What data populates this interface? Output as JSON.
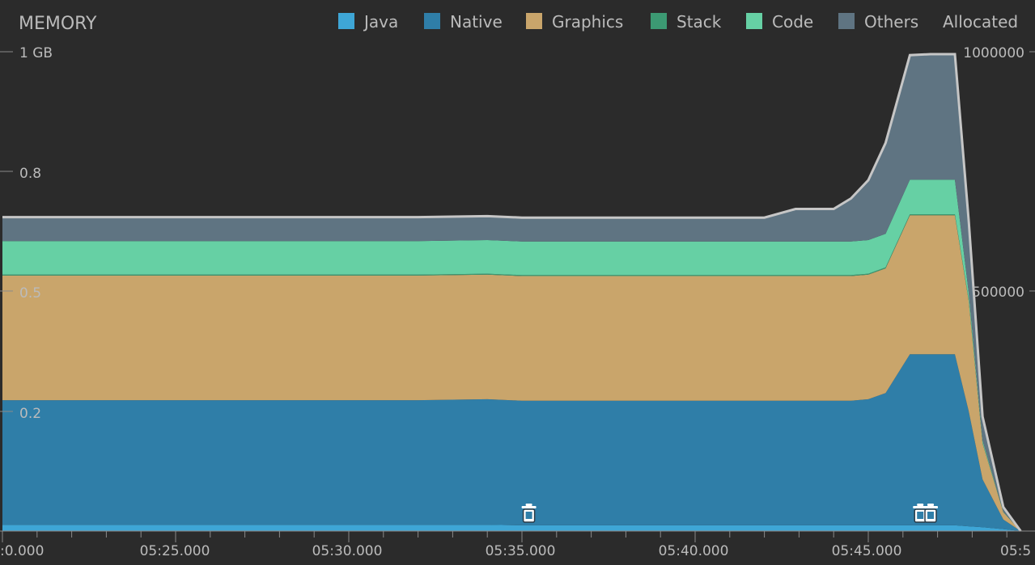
{
  "panel": {
    "title": "MEMORY"
  },
  "legend": [
    {
      "name": "Java",
      "color": "#3ea6d6"
    },
    {
      "name": "Native",
      "color": "#2f7ea8"
    },
    {
      "name": "Graphics",
      "color": "#c9a56b"
    },
    {
      "name": "Stack",
      "color": "#3c9a73"
    },
    {
      "name": "Code",
      "color": "#66d0a4"
    },
    {
      "name": "Others",
      "color": "#5f7482"
    },
    {
      "name": "Allocated",
      "color": null
    }
  ],
  "colors": {
    "background": "#2b2b2b",
    "total_line": "#c6c6c6",
    "axis": "#8a8a8a",
    "text": "#bbbbbb"
  },
  "chart_data": {
    "type": "area",
    "stacked": true,
    "x_tick_labels": [
      ":0.000",
      "05:25.000",
      "05:30.000",
      "05:35.000",
      "05:40.000",
      "05:45.000",
      "05:5"
    ],
    "y_left": {
      "unit": "GB",
      "ylim": [
        0,
        1
      ],
      "tick_labels": [
        "1 GB",
        "0.8",
        "0.5",
        "0.2"
      ]
    },
    "y_right": {
      "ylim": [
        0,
        1000000
      ],
      "tick_labels": [
        "1000000",
        "500000"
      ]
    },
    "x": [
      0,
      2,
      4,
      6,
      8,
      10,
      12,
      14,
      15,
      19,
      22,
      22.9,
      24,
      24.5,
      25,
      25.5,
      26.2,
      26.8,
      27.5,
      27.9,
      28.3,
      28.9,
      29.4
    ],
    "series": [
      {
        "name": "Java",
        "values": [
          0.013,
          0.013,
          0.013,
          0.013,
          0.013,
          0.013,
          0.013,
          0.013,
          0.012,
          0.012,
          0.012,
          0.012,
          0.012,
          0.012,
          0.012,
          0.012,
          0.012,
          0.012,
          0.012,
          0.01,
          0.008,
          0.004,
          0.0
        ]
      },
      {
        "name": "Native",
        "values": [
          0.26,
          0.26,
          0.26,
          0.26,
          0.26,
          0.26,
          0.26,
          0.262,
          0.26,
          0.26,
          0.26,
          0.26,
          0.26,
          0.26,
          0.263,
          0.276,
          0.357,
          0.357,
          0.357,
          0.24,
          0.1,
          0.02,
          0.0
        ]
      },
      {
        "name": "Graphics",
        "values": [
          0.26,
          0.26,
          0.26,
          0.26,
          0.26,
          0.26,
          0.26,
          0.26,
          0.26,
          0.26,
          0.26,
          0.26,
          0.26,
          0.26,
          0.26,
          0.26,
          0.29,
          0.29,
          0.29,
          0.23,
          0.075,
          0.015,
          0.0
        ]
      },
      {
        "name": "Stack",
        "values": [
          0.002,
          0.002,
          0.002,
          0.002,
          0.002,
          0.002,
          0.002,
          0.002,
          0.002,
          0.002,
          0.002,
          0.002,
          0.002,
          0.002,
          0.002,
          0.002,
          0.002,
          0.002,
          0.002,
          0.002,
          0.001,
          0.0,
          0.0
        ]
      },
      {
        "name": "Code",
        "values": [
          0.07,
          0.07,
          0.07,
          0.07,
          0.07,
          0.07,
          0.07,
          0.07,
          0.07,
          0.07,
          0.07,
          0.07,
          0.07,
          0.07,
          0.07,
          0.07,
          0.072,
          0.072,
          0.072,
          0.015,
          0.005,
          0.001,
          0.0
        ]
      },
      {
        "name": "Others",
        "values": [
          0.05,
          0.05,
          0.05,
          0.05,
          0.05,
          0.05,
          0.05,
          0.05,
          0.05,
          0.05,
          0.05,
          0.068,
          0.068,
          0.09,
          0.125,
          0.19,
          0.26,
          0.262,
          0.262,
          0.15,
          0.05,
          0.01,
          0.0
        ]
      }
    ],
    "gc_event_x": [
      15.2,
      26.5,
      26.8
    ]
  }
}
